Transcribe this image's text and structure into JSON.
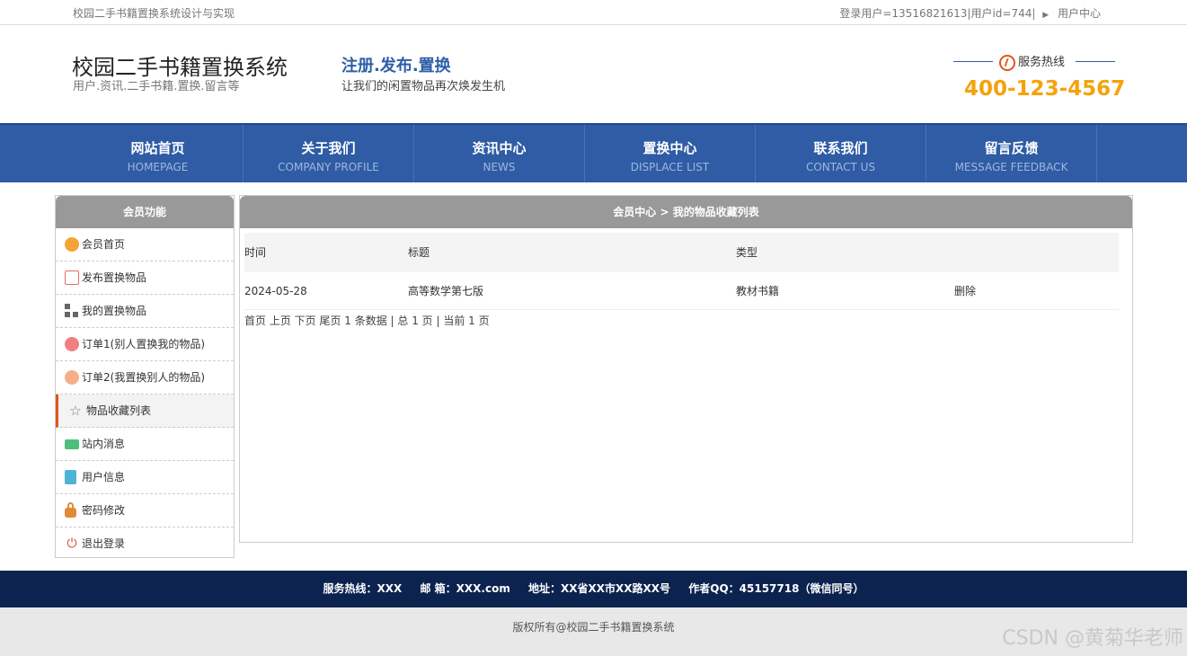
{
  "topbar": {
    "left_text": "校园二手书籍置换系统设计与实现",
    "user_text": "登录用户=13516821613|用户id=744|",
    "user_center": "用户中心"
  },
  "header": {
    "site_title": "校园二手书籍置换系统",
    "site_subtitle": "用户.资讯.二手书籍.置换.留言等",
    "slogan": "注册.发布.置换",
    "slogan_sub": "让我们的闲置物品再次焕发生机",
    "hotline_label": "服务热线",
    "hotline_number": "400-123-4567"
  },
  "nav": [
    {
      "cn": "网站首页",
      "en": "HOMEPAGE"
    },
    {
      "cn": "关于我们",
      "en": "COMPANY PROFILE"
    },
    {
      "cn": "资讯中心",
      "en": "NEWS"
    },
    {
      "cn": "置换中心",
      "en": "DISPLACE LIST"
    },
    {
      "cn": "联系我们",
      "en": "CONTACT US"
    },
    {
      "cn": "留言反馈",
      "en": "MESSAGE FEEDBACK"
    }
  ],
  "sidebar": {
    "title": "会员功能",
    "items": [
      {
        "label": "会员首页",
        "icon": "member-home-icon"
      },
      {
        "label": "发布置换物品",
        "icon": "edit-icon"
      },
      {
        "label": "我的置换物品",
        "icon": "grid-icon"
      },
      {
        "label": "订单1(别人置换我的物品)",
        "icon": "order-icon"
      },
      {
        "label": "订单2(我置换别人的物品)",
        "icon": "order-icon"
      },
      {
        "label": "物品收藏列表",
        "icon": "star-icon",
        "active": true
      },
      {
        "label": "站内消息",
        "icon": "card-icon"
      },
      {
        "label": "用户信息",
        "icon": "clipboard-icon"
      },
      {
        "label": "密码修改",
        "icon": "lock-icon"
      },
      {
        "label": "退出登录",
        "icon": "power-icon"
      }
    ]
  },
  "main": {
    "breadcrumb": "会员中心 > 我的物品收藏列表",
    "columns": [
      "时间",
      "标题",
      "类型",
      ""
    ],
    "rows": [
      {
        "time": "2024-05-28",
        "title": "高等数学第七版",
        "type": "教材书籍",
        "action": "删除"
      }
    ],
    "pager": "首页 上页 下页 尾页 1 条数据 | 总 1 页 | 当前 1 页"
  },
  "footer": {
    "hotline": "服务热线：XXX",
    "email": "邮 箱：XXX.com",
    "address": "地址：XX省XX市XX路XX号",
    "qq": "作者QQ：45157718（微信同号）",
    "copyright": "版权所有@校园二手书籍置换系统"
  },
  "watermark": "CSDN @黄菊华老师",
  "colors": {
    "nav_bg": "#2f5ca4",
    "accent_orange": "#f5a20a",
    "footer_bg": "#0c2350",
    "panel_header": "#999999"
  }
}
